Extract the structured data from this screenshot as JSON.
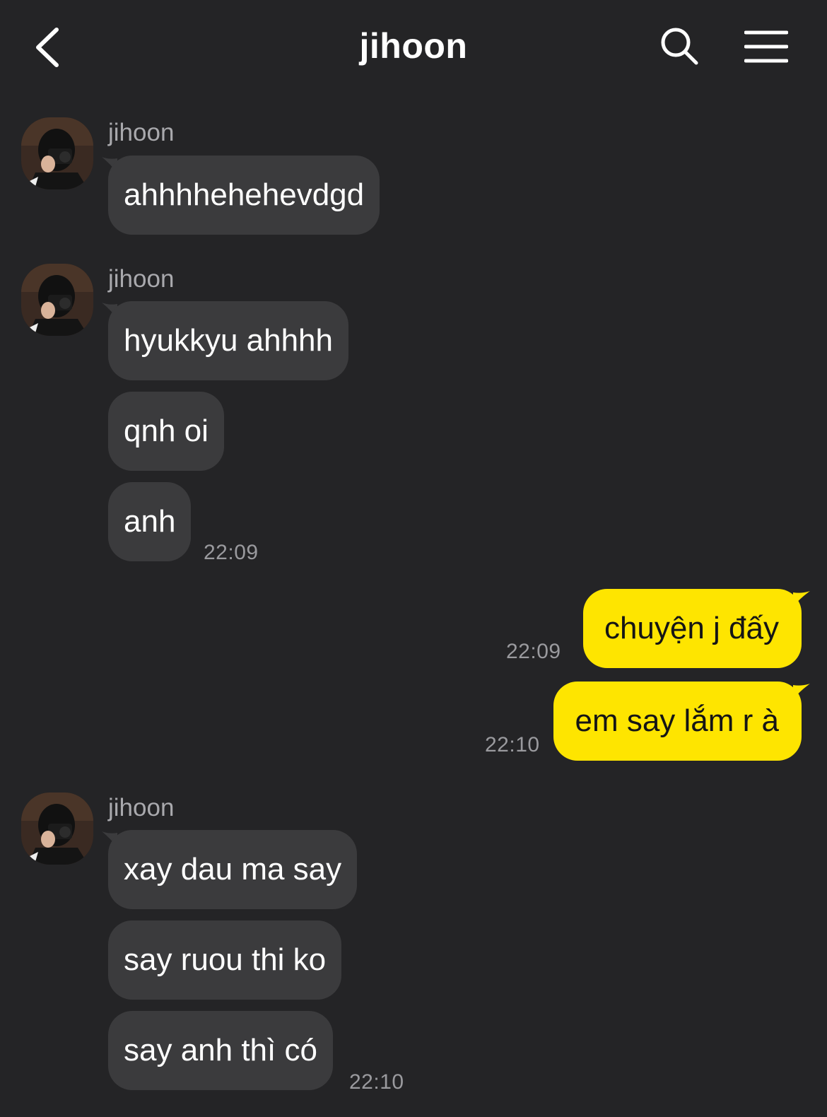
{
  "header": {
    "title": "jihoon"
  },
  "icons": {
    "back": "chevron-left-icon",
    "search": "search-icon",
    "menu": "hamburger-menu-icon"
  },
  "colors": {
    "background": "#242426",
    "incoming_bubble": "#3b3b3d",
    "outgoing_bubble": "#fee500"
  },
  "messages": [
    {
      "sender": "jihoon",
      "texts": [
        "ahhhhehehevdgd"
      ]
    },
    {
      "sender": "jihoon",
      "texts": [
        "hyukkyu ahhhh",
        "qnh oi",
        "anh"
      ],
      "time": "22:09"
    },
    {
      "outgoing": [
        {
          "text": "chuyện j đấy",
          "time": "22:09"
        },
        {
          "text": "em say lắm r à",
          "time": "22:10"
        }
      ]
    },
    {
      "sender": "jihoon",
      "texts": [
        "xay dau ma say",
        "say ruou thi ko",
        "say anh thì có"
      ],
      "time": "22:10"
    }
  ]
}
